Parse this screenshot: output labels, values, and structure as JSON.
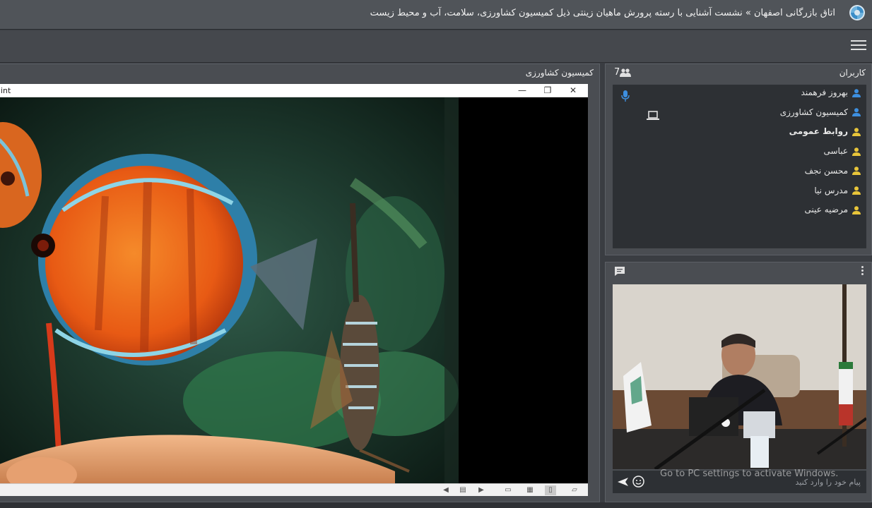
{
  "header": {
    "title": "اتاق بازرگانی اصفهان » نشست آشنایی با رسته پرورش ماهیان زینتی ذیل کمیسیون کشاورزی، سلامت، آب و محیط زیست",
    "logo_icon": "spiral-logo-icon"
  },
  "toolbar": {
    "menu_icon": "hamburger-menu-icon"
  },
  "share_pod": {
    "title": "کمیسیون کشاورزی",
    "window": {
      "app_name": "int",
      "minimize": "—",
      "restore": "❐",
      "close": "✕"
    }
  },
  "users_pod": {
    "title": "کاربران",
    "count": "7",
    "users": [
      {
        "name": "بهروز فرهمند",
        "color": "#3d8fe0",
        "bold": false
      },
      {
        "name": "کمیسیون کشاورزی",
        "color": "#3d8fe0",
        "bold": false
      },
      {
        "name": "روابط عمومی",
        "color": "#e8c53a",
        "bold": true
      },
      {
        "name": "عباسی",
        "color": "#e8c53a",
        "bold": false
      },
      {
        "name": "محسن نجف",
        "color": "#e8c53a",
        "bold": false
      },
      {
        "name": "مدرس نیا",
        "color": "#e8c53a",
        "bold": false
      },
      {
        "name": "مرضیه عینی",
        "color": "#e8c53a",
        "bold": false
      }
    ]
  },
  "chat_pod": {
    "placeholder": "پیام خود را وارد کنید"
  },
  "watermark": "Go to PC settings to activate Windows."
}
